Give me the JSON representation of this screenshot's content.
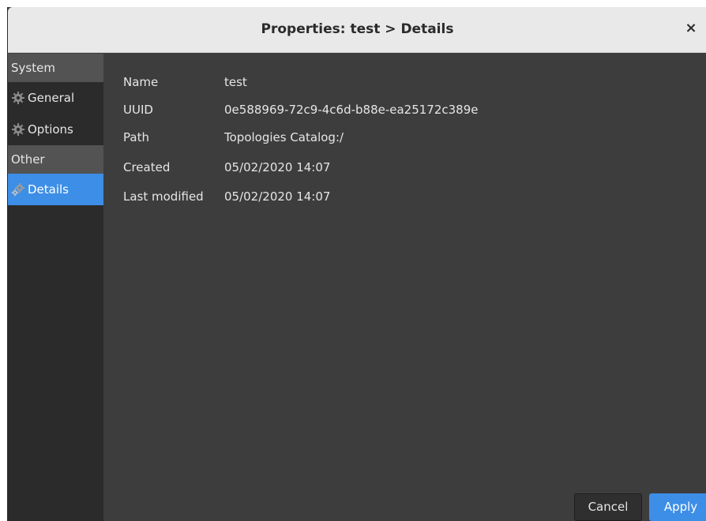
{
  "window": {
    "title": "Properties: test > Details",
    "close_icon_label": "×"
  },
  "sidebar": {
    "sections": [
      {
        "header": "System",
        "items": [
          {
            "label": "General",
            "icon": "gear-icon"
          },
          {
            "label": "Options",
            "icon": "gear-icon"
          }
        ]
      },
      {
        "header": "Other",
        "items": [
          {
            "label": "Details",
            "icon": "gears-detail-icon",
            "selected": true
          }
        ]
      }
    ]
  },
  "details": {
    "rows": [
      {
        "label": "Name",
        "value": "test"
      },
      {
        "label": "UUID",
        "value": "0e588969-72c9-4c6d-b88e-ea25172c389e"
      },
      {
        "label": "Path",
        "value": "Topologies Catalog:/"
      },
      {
        "label": "Created",
        "value": "05/02/2020 14:07"
      },
      {
        "label": "Last modified",
        "value": "05/02/2020 14:07"
      }
    ]
  },
  "buttons": {
    "cancel_label": "Cancel",
    "apply_label": "Apply"
  },
  "colors": {
    "accent": "#3d8ee6",
    "background": "#3d3d3d",
    "sidebar": "#2b2b2b",
    "section_header": "#535353"
  }
}
